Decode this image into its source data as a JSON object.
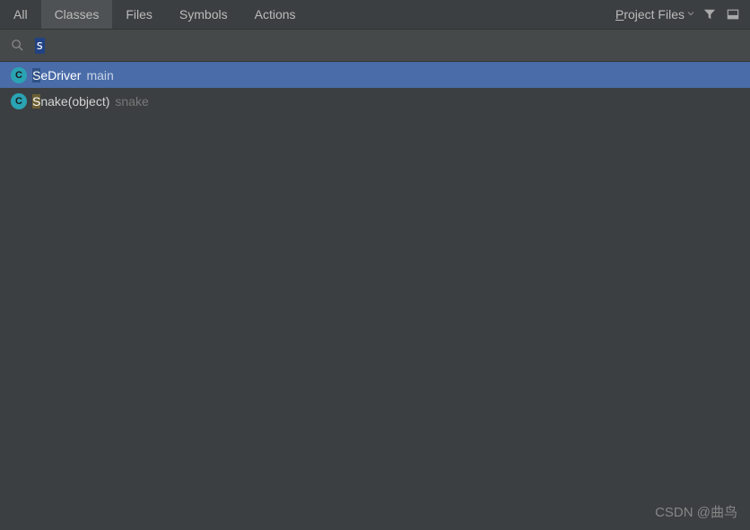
{
  "tabs": {
    "all": "All",
    "classes": "Classes",
    "files": "Files",
    "symbols": "Symbols",
    "actions": "Actions"
  },
  "scope": {
    "prefix": "P",
    "rest": "roject Files"
  },
  "search": {
    "query": "s"
  },
  "results": [
    {
      "match_prefix": "S",
      "name_rest": "eDriver",
      "location": "main",
      "selected": true
    },
    {
      "match_prefix": "S",
      "name_rest": "nake(object)",
      "location": "snake",
      "selected": false
    }
  ],
  "watermark": "CSDN @曲鸟"
}
